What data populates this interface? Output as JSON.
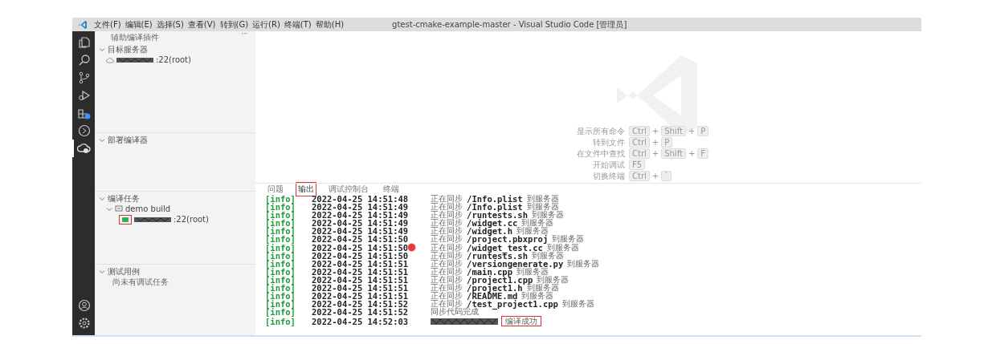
{
  "menu": [
    "文件(F)",
    "编辑(E)",
    "选择(S)",
    "查看(V)",
    "转到(G)",
    "运行(R)",
    "终端(T)",
    "帮助(H)"
  ],
  "window": {
    "title": "gtest-cmake-example-master - Visual Studio Code [管理员]"
  },
  "activity_bar": [
    {
      "kind": "explorer",
      "selected": false
    },
    {
      "kind": "search",
      "selected": false
    },
    {
      "kind": "source-control",
      "selected": false
    },
    {
      "kind": "run",
      "selected": false
    },
    {
      "kind": "extensions",
      "selected": false
    },
    {
      "kind": "remote",
      "selected": false
    },
    {
      "kind": "plugin",
      "selected": true
    },
    {
      "kind": "account",
      "selected": false
    },
    {
      "kind": "settings",
      "selected": false
    }
  ],
  "sidebar": {
    "title": "辅助编译插件",
    "more": "···",
    "sections": [
      {
        "title": "目标服务器",
        "expanded": true,
        "items": [
          {
            "kind": "server",
            "redacted": true,
            "label": ":22(root)",
            "highlighted": false
          }
        ]
      },
      {
        "title": "部署编译器",
        "expanded": true
      },
      {
        "title": "编译任务",
        "expanded": true,
        "items": [
          {
            "kind": "task",
            "label": "demo build",
            "expanded": true,
            "children": [
              {
                "redacted": true,
                "label": ":22(root)",
                "highlighted": true
              }
            ]
          }
        ]
      },
      {
        "title": "测试用例",
        "expanded": true,
        "items": [
          {
            "kind": "message",
            "label": "尚未有调试任务"
          }
        ]
      }
    ]
  },
  "shortcuts": [
    {
      "label": "显示所有命令",
      "keys": [
        "Ctrl",
        "Shift",
        "P"
      ]
    },
    {
      "label": "转到文件",
      "keys": [
        "Ctrl",
        "P"
      ]
    },
    {
      "label": "在文件中查找",
      "keys": [
        "Ctrl",
        "Shift",
        "F"
      ]
    },
    {
      "label": "开始调试",
      "keys": [
        "F5"
      ]
    },
    {
      "label": "切换终端",
      "keys": [
        "Ctrl",
        "`"
      ]
    }
  ],
  "key_joiner": "+",
  "panel": {
    "tabs": [
      {
        "label": "问题",
        "selected": false
      },
      {
        "label": "输出",
        "selected": true
      },
      {
        "label": "调试控制台",
        "selected": false
      },
      {
        "label": "终端",
        "selected": false
      }
    ],
    "lines": [
      {
        "kind": "sync",
        "tag": "[info]",
        "time": "2022-04-25 14:51:48",
        "prefix": "正在同步",
        "path": "/Info.plist",
        "suffix": "到服务器"
      },
      {
        "kind": "sync",
        "tag": "[info]",
        "time": "2022-04-25 14:51:49",
        "prefix": "正在同步",
        "path": "/Info.plist",
        "suffix": "到服务器"
      },
      {
        "kind": "sync",
        "tag": "[info]",
        "time": "2022-04-25 14:51:49",
        "prefix": "正在同步",
        "path": "/runtests.sh",
        "suffix": "到服务器"
      },
      {
        "kind": "sync",
        "tag": "[info]",
        "time": "2022-04-25 14:51:49",
        "prefix": "正在同步",
        "path": "/widget.cc",
        "suffix": "到服务器"
      },
      {
        "kind": "sync",
        "tag": "[info]",
        "time": "2022-04-25 14:51:49",
        "prefix": "正在同步",
        "path": "/widget.h",
        "suffix": "到服务器"
      },
      {
        "kind": "sync",
        "tag": "[info]",
        "time": "2022-04-25 14:51:50",
        "prefix": "正在同步",
        "path": "/project.pbxproj",
        "suffix": "到服务器"
      },
      {
        "kind": "sync",
        "tag": "[info]",
        "time": "2022-04-25 14:51:50",
        "prefix": "正在同步",
        "path": "/widget_test.cc",
        "suffix": "到服务器",
        "cursor": true
      },
      {
        "kind": "sync",
        "tag": "[info]",
        "time": "2022-04-25 14:51:50",
        "prefix": "正在同步",
        "path": "/runtests.sh",
        "suffix": "到服务器"
      },
      {
        "kind": "sync",
        "tag": "[info]",
        "time": "2022-04-25 14:51:51",
        "prefix": "正在同步",
        "path": "/versiongenerate.py",
        "suffix": "到服务器"
      },
      {
        "kind": "sync",
        "tag": "[info]",
        "time": "2022-04-25 14:51:51",
        "prefix": "正在同步",
        "path": "/main.cpp",
        "suffix": "到服务器"
      },
      {
        "kind": "sync",
        "tag": "[info]",
        "time": "2022-04-25 14:51:51",
        "prefix": "正在同步",
        "path": "/project1.cpp",
        "suffix": "到服务器"
      },
      {
        "kind": "sync",
        "tag": "[info]",
        "time": "2022-04-25 14:51:51",
        "prefix": "正在同步",
        "path": "/project1.h",
        "suffix": "到服务器"
      },
      {
        "kind": "sync",
        "tag": "[info]",
        "time": "2022-04-25 14:51:51",
        "prefix": "正在同步",
        "path": "/README.md",
        "suffix": "到服务器"
      },
      {
        "kind": "sync",
        "tag": "[info]",
        "time": "2022-04-25 14:51:52",
        "prefix": "正在同步",
        "path": "/test_project1.cpp",
        "suffix": "到服务器"
      },
      {
        "kind": "message",
        "tag": "[info]",
        "time": "2022-04-25 14:51:52",
        "message": "同步代码完成"
      },
      {
        "kind": "result",
        "tag": "[info]",
        "time": "2022-04-25 14:52:03",
        "redacted": true,
        "message": "编译成功"
      }
    ]
  }
}
